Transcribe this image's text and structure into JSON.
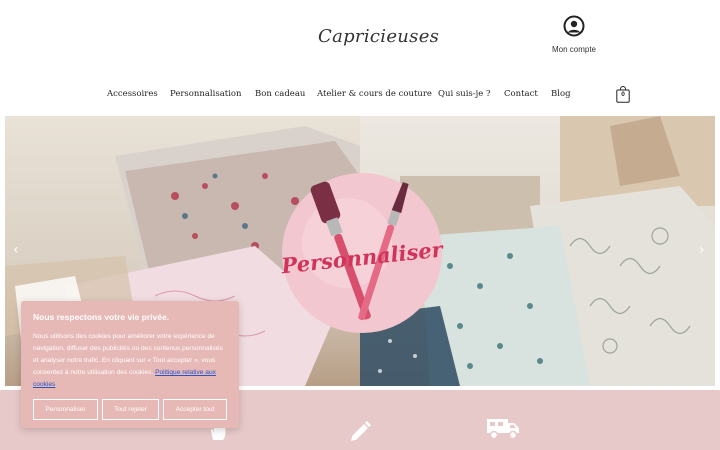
{
  "header": {
    "logo_text": "Capricieuses",
    "account_label": "Mon compte",
    "account_icon": "user-circle-icon",
    "cart_count": "0",
    "cart_icon": "shopping-bag-icon"
  },
  "nav": {
    "items": [
      {
        "label": "Accessoires"
      },
      {
        "label": "Personnalisation"
      },
      {
        "label": "Bon cadeau"
      },
      {
        "label": "Atelier & cours de couture"
      },
      {
        "label": "Qui suis-je ?"
      },
      {
        "label": "Contact"
      },
      {
        "label": "Blog"
      }
    ]
  },
  "hero": {
    "badge_text": "Personnaliser",
    "prev_icon": "chevron-left-icon",
    "next_icon": "chevron-right-icon",
    "slide_count": 2,
    "active_slide": 1
  },
  "features": {
    "icons": [
      "hand-icon",
      "pencil-icon",
      "delivery-truck-icon"
    ]
  },
  "cookie_banner": {
    "title": "Nous respectons votre vie privée.",
    "text": "Nous utilisons des cookies pour améliorer votre expérience de navigation, diffuser des publicités ou des contenus personnalisés et analyser notre trafic. En cliquant sur « Tout accepter », vous consentez à notre utilisation des cookies.",
    "policy_link": "Politique relative aux cookies",
    "buttons": {
      "customize": "Personnaliser",
      "reject": "Tout rejeter",
      "accept": "Accepter tout"
    }
  },
  "colors": {
    "band": "#e7c9c9",
    "cookie_bg": "#e6b8b6",
    "badge_pink": "#d1345b",
    "link_blue": "#2a55c9"
  }
}
